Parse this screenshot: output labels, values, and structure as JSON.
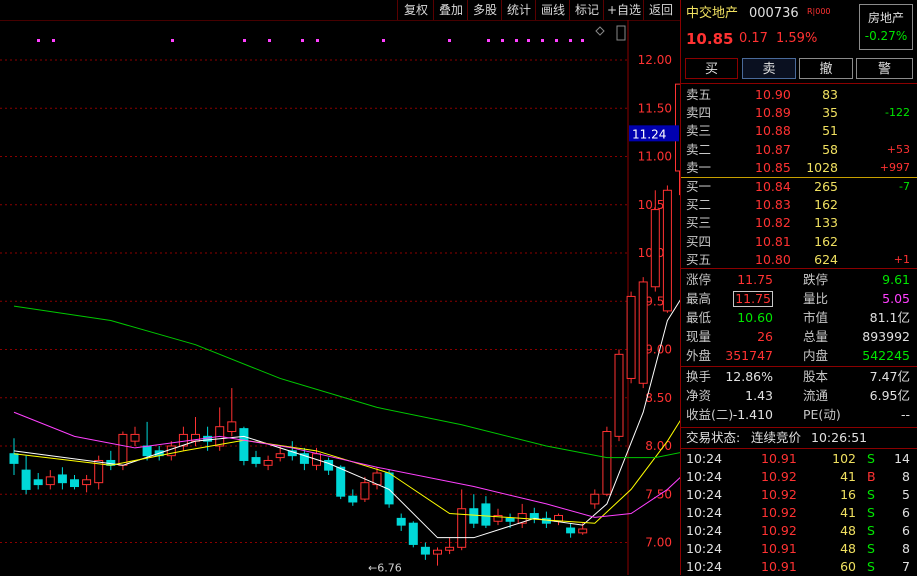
{
  "toolbar": {
    "items": [
      "复权",
      "叠加",
      "多股",
      "统计",
      "画线",
      "标记",
      "+自选",
      "返回"
    ]
  },
  "stock": {
    "name": "中交地产",
    "code": "000736",
    "tag": "R|000",
    "sector": "房地产",
    "sector_change": "-0.27%",
    "price": "10.85",
    "change": "0.17",
    "change_pct": "1.59%"
  },
  "buttons": {
    "buy": "买",
    "sell": "卖",
    "cancel": "撤",
    "alert": "警"
  },
  "asks": [
    {
      "label": "卖五",
      "price": "10.90",
      "vol": "83",
      "chg": ""
    },
    {
      "label": "卖四",
      "price": "10.89",
      "vol": "35",
      "chg": "-122"
    },
    {
      "label": "卖三",
      "price": "10.88",
      "vol": "51",
      "chg": ""
    },
    {
      "label": "卖二",
      "price": "10.87",
      "vol": "58",
      "chg": "+53"
    },
    {
      "label": "卖一",
      "price": "10.85",
      "vol": "1028",
      "chg": "+997"
    }
  ],
  "bids": [
    {
      "label": "买一",
      "price": "10.84",
      "vol": "265",
      "chg": "-7"
    },
    {
      "label": "买二",
      "price": "10.83",
      "vol": "162",
      "chg": ""
    },
    {
      "label": "买三",
      "price": "10.82",
      "vol": "133",
      "chg": ""
    },
    {
      "label": "买四",
      "price": "10.81",
      "vol": "162",
      "chg": ""
    },
    {
      "label": "买五",
      "price": "10.80",
      "vol": "624",
      "chg": "+1"
    }
  ],
  "stats1": [
    {
      "l1": "涨停",
      "v1": "11.75",
      "l2": "跌停",
      "v2": "9.61"
    },
    {
      "l1": "最高",
      "v1": "11.75",
      "l2": "量比",
      "v2": "5.05"
    },
    {
      "l1": "最低",
      "v1": "10.60",
      "l2": "市值",
      "v2": "81.1亿"
    },
    {
      "l1": "现量",
      "v1": "26",
      "l2": "总量",
      "v2": "893992"
    },
    {
      "l1": "外盘",
      "v1": "351747",
      "l2": "内盘",
      "v2": "542245"
    }
  ],
  "stats2": [
    {
      "l1": "换手",
      "v1": "12.86%",
      "l2": "股本",
      "v2": "7.47亿"
    },
    {
      "l1": "净资",
      "v1": "1.43",
      "l2": "流通",
      "v2": "6.95亿"
    },
    {
      "l1": "收益(二)",
      "v1": "-1.410",
      "l2": "PE(动)",
      "v2": "--"
    }
  ],
  "auction": {
    "label": "交易状态:",
    "state": "连续竞价",
    "time": "10:26:51"
  },
  "ticks": [
    {
      "t": "10:24",
      "p": "10.91",
      "v": "102",
      "bs": "S",
      "n": "14"
    },
    {
      "t": "10:24",
      "p": "10.92",
      "v": "41",
      "bs": "B",
      "n": "8"
    },
    {
      "t": "10:24",
      "p": "10.92",
      "v": "16",
      "bs": "S",
      "n": "5"
    },
    {
      "t": "10:24",
      "p": "10.92",
      "v": "41",
      "bs": "S",
      "n": "6"
    },
    {
      "t": "10:24",
      "p": "10.92",
      "v": "48",
      "bs": "S",
      "n": "6"
    },
    {
      "t": "10:24",
      "p": "10.91",
      "v": "48",
      "bs": "S",
      "n": "8"
    },
    {
      "t": "10:24",
      "p": "10.91",
      "v": "60",
      "bs": "S",
      "n": "7"
    }
  ],
  "chart_data": {
    "type": "candlestick",
    "y_ticks": [
      "12.00",
      "11.50",
      "11.00",
      "10.50",
      "10.00",
      "9.50",
      "9.00",
      "8.50",
      "8.00",
      "7.50",
      "7.00"
    ],
    "ylim": [
      6.9,
      12.0
    ],
    "crosshair_label": "11.24",
    "low_annotation": "←6.76",
    "candles": [
      [
        7.92,
        7.82,
        8.08,
        7.7
      ],
      [
        7.75,
        7.55,
        7.9,
        7.5
      ],
      [
        7.65,
        7.6,
        7.72,
        7.55
      ],
      [
        7.6,
        7.68,
        7.75,
        7.55
      ],
      [
        7.7,
        7.62,
        7.78,
        7.55
      ],
      [
        7.65,
        7.58,
        7.7,
        7.55
      ],
      [
        7.6,
        7.65,
        7.7,
        7.52
      ],
      [
        7.62,
        7.85,
        7.9,
        7.55
      ],
      [
        7.85,
        7.8,
        7.95,
        7.75
      ],
      [
        7.8,
        8.12,
        8.15,
        7.75
      ],
      [
        8.05,
        8.12,
        8.2,
        8.0
      ],
      [
        8.0,
        7.9,
        8.25,
        7.85
      ],
      [
        7.95,
        7.9,
        8.0,
        7.85
      ],
      [
        7.9,
        8.0,
        8.05,
        7.85
      ],
      [
        8.0,
        8.12,
        8.2,
        7.95
      ],
      [
        8.05,
        8.12,
        8.3,
        8.0
      ],
      [
        8.1,
        8.05,
        8.2,
        7.95
      ],
      [
        8.0,
        8.2,
        8.4,
        7.95
      ],
      [
        8.15,
        8.25,
        8.6,
        8.1
      ],
      [
        8.18,
        7.85,
        8.2,
        7.8
      ],
      [
        7.88,
        7.82,
        7.95,
        7.78
      ],
      [
        7.8,
        7.85,
        7.9,
        7.75
      ],
      [
        7.88,
        7.92,
        8.0,
        7.84
      ],
      [
        7.95,
        7.9,
        8.05,
        7.85
      ],
      [
        7.92,
        7.82,
        7.98,
        7.75
      ],
      [
        7.8,
        7.92,
        7.98,
        7.75
      ],
      [
        7.85,
        7.75,
        7.88,
        7.7
      ],
      [
        7.78,
        7.48,
        7.8,
        7.45
      ],
      [
        7.48,
        7.42,
        7.55,
        7.38
      ],
      [
        7.45,
        7.62,
        7.68,
        7.42
      ],
      [
        7.6,
        7.72,
        7.78,
        7.55
      ],
      [
        7.72,
        7.4,
        7.75,
        7.36
      ],
      [
        7.25,
        7.18,
        7.3,
        7.12
      ],
      [
        7.2,
        6.98,
        7.22,
        6.95
      ],
      [
        6.95,
        6.88,
        7.0,
        6.82
      ],
      [
        6.88,
        6.92,
        6.95,
        6.76
      ],
      [
        6.92,
        6.95,
        7.05,
        6.88
      ],
      [
        6.95,
        7.35,
        7.55,
        6.92
      ],
      [
        7.35,
        7.2,
        7.5,
        7.15
      ],
      [
        7.4,
        7.18,
        7.48,
        7.15
      ],
      [
        7.22,
        7.28,
        7.35,
        7.18
      ],
      [
        7.25,
        7.22,
        7.3,
        7.15
      ],
      [
        7.2,
        7.3,
        7.4,
        7.15
      ],
      [
        7.3,
        7.25,
        7.36,
        7.2
      ],
      [
        7.25,
        7.2,
        7.32,
        7.15
      ],
      [
        7.22,
        7.28,
        7.3,
        7.18
      ],
      [
        7.15,
        7.1,
        7.2,
        7.05
      ],
      [
        7.1,
        7.14,
        7.2,
        7.08
      ],
      [
        7.4,
        7.5,
        7.55,
        7.35
      ],
      [
        7.5,
        8.15,
        8.2,
        7.48
      ],
      [
        8.1,
        8.95,
        9.0,
        8.05
      ],
      [
        8.7,
        9.55,
        9.6,
        8.65
      ],
      [
        8.65,
        9.7,
        9.75,
        8.6
      ],
      [
        9.65,
        10.45,
        10.65,
        9.6
      ],
      [
        9.4,
        10.65,
        10.7,
        9.38
      ],
      [
        10.85,
        11.75,
        11.75,
        10.6
      ]
    ],
    "ma": [
      {
        "name": "MA5",
        "color": "#ffffff",
        "values": [
          [
            0,
            7.95
          ],
          [
            9,
            7.8
          ],
          [
            15,
            8.05
          ],
          [
            19,
            8.1
          ],
          [
            26,
            7.82
          ],
          [
            31,
            7.55
          ],
          [
            35,
            7.05
          ],
          [
            38,
            7.05
          ],
          [
            43,
            7.25
          ],
          [
            47,
            7.18
          ],
          [
            49,
            7.4
          ],
          [
            52,
            8.35
          ],
          [
            54,
            9.3
          ],
          [
            57,
            9.9
          ]
        ]
      },
      {
        "name": "MA10",
        "color": "#ffff00",
        "values": [
          [
            0,
            7.92
          ],
          [
            8,
            7.8
          ],
          [
            14,
            7.95
          ],
          [
            19,
            8.06
          ],
          [
            25,
            7.95
          ],
          [
            31,
            7.72
          ],
          [
            36,
            7.3
          ],
          [
            42,
            7.25
          ],
          [
            48,
            7.2
          ],
          [
            51,
            7.55
          ],
          [
            54,
            8.05
          ],
          [
            57,
            8.65
          ]
        ]
      },
      {
        "name": "MA20",
        "color": "#ff40ff",
        "values": [
          [
            0,
            8.35
          ],
          [
            5,
            8.1
          ],
          [
            10,
            7.98
          ],
          [
            17,
            8.1
          ],
          [
            23,
            7.98
          ],
          [
            30,
            7.78
          ],
          [
            38,
            7.58
          ],
          [
            44,
            7.4
          ],
          [
            48,
            7.26
          ],
          [
            51,
            7.3
          ],
          [
            54,
            7.55
          ],
          [
            57,
            7.9
          ]
        ]
      },
      {
        "name": "MA60",
        "color": "#00c800",
        "values": [
          [
            0,
            9.45
          ],
          [
            8,
            9.3
          ],
          [
            15,
            9.05
          ],
          [
            22,
            8.7
          ],
          [
            30,
            8.4
          ],
          [
            37,
            8.22
          ],
          [
            44,
            8.0
          ],
          [
            49,
            7.88
          ],
          [
            53,
            7.88
          ],
          [
            57,
            7.98
          ]
        ]
      }
    ]
  },
  "colors": {
    "up": "#ff3232",
    "down": "#00d8d8",
    "grid": "#8b0000"
  }
}
